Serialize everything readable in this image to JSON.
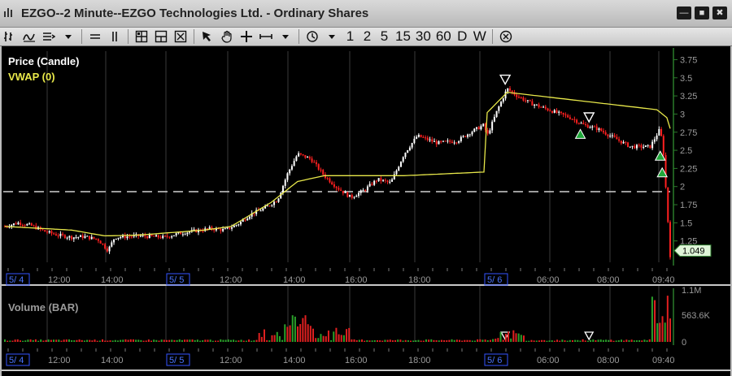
{
  "window": {
    "title": "EZGO--2 Minute--EZGO Technologies Ltd. - Ordinary Shares",
    "buttons": [
      "—",
      "■",
      "✖"
    ]
  },
  "toolbar": {
    "timeframes": [
      "1",
      "2",
      "5",
      "15",
      "30",
      "60",
      "D",
      "W"
    ]
  },
  "price_panel": {
    "legend": [
      {
        "label": "Price (Candle)",
        "color": "#ffffff"
      },
      {
        "label": "VWAP (0)",
        "color": "#e8e84a"
      }
    ],
    "y_ticks": [
      "3.75",
      "3.5",
      "3.25",
      "3",
      "2.75",
      "2.5",
      "2.25",
      "2",
      "1.75",
      "1.5",
      "1.25"
    ],
    "last_price": "1.049"
  },
  "volume_panel": {
    "legend": "Volume (BAR)",
    "y_ticks": [
      "1.1M",
      "563.6K",
      "0"
    ]
  },
  "x_axis": {
    "date_labels": [
      "5/ 4",
      "5/ 5",
      "5/ 6"
    ],
    "time_labels": [
      "12:00",
      "14:00",
      "12:00",
      "14:00",
      "16:00",
      "18:00",
      "06:00",
      "08:00",
      "09:40"
    ]
  },
  "colors": {
    "up": "#ffffff",
    "down": "#ff2020",
    "vwap": "#e8e84a",
    "vol_up": "#2aa02a",
    "vol_down": "#e02020",
    "grid": "#3a3a3a",
    "axis_text": "#9a9a9a",
    "date_box": "#3355ff"
  },
  "chart_data": {
    "type": "candlestick",
    "symbol": "EZGO",
    "interval": "2 Minute",
    "ylim": [
      1.0,
      3.8
    ],
    "price_path": [
      [
        0,
        1.45
      ],
      [
        0.02,
        1.5
      ],
      [
        0.04,
        1.46
      ],
      [
        0.06,
        1.38
      ],
      [
        0.08,
        1.33
      ],
      [
        0.1,
        1.3
      ],
      [
        0.12,
        1.31
      ],
      [
        0.14,
        1.27
      ],
      [
        0.155,
        1.12
      ],
      [
        0.165,
        1.3
      ],
      [
        0.2,
        1.32
      ],
      [
        0.24,
        1.3
      ],
      [
        0.26,
        1.35
      ],
      [
        0.28,
        1.38
      ],
      [
        0.31,
        1.42
      ],
      [
        0.33,
        1.4
      ],
      [
        0.35,
        1.48
      ],
      [
        0.37,
        1.62
      ],
      [
        0.39,
        1.7
      ],
      [
        0.41,
        1.82
      ],
      [
        0.425,
        2.18
      ],
      [
        0.44,
        2.45
      ],
      [
        0.46,
        2.38
      ],
      [
        0.48,
        2.15
      ],
      [
        0.5,
        1.98
      ],
      [
        0.52,
        1.85
      ],
      [
        0.54,
        1.95
      ],
      [
        0.56,
        2.1
      ],
      [
        0.58,
        2.05
      ],
      [
        0.6,
        2.45
      ],
      [
        0.62,
        2.7
      ],
      [
        0.65,
        2.6
      ],
      [
        0.68,
        2.63
      ],
      [
        0.7,
        2.75
      ],
      [
        0.72,
        2.85
      ],
      [
        0.725,
        2.7
      ],
      [
        0.74,
        3.05
      ],
      [
        0.755,
        3.35
      ],
      [
        0.77,
        3.25
      ],
      [
        0.79,
        3.15
      ],
      [
        0.82,
        3.05
      ],
      [
        0.85,
        2.95
      ],
      [
        0.87,
        2.85
      ],
      [
        0.89,
        2.8
      ],
      [
        0.91,
        2.7
      ],
      [
        0.94,
        2.55
      ],
      [
        0.97,
        2.55
      ],
      [
        0.985,
        2.8
      ],
      [
        0.99,
        2.45
      ],
      [
        1.0,
        1.05
      ]
    ],
    "vwap_path": [
      [
        0,
        1.45
      ],
      [
        0.1,
        1.4
      ],
      [
        0.15,
        1.32
      ],
      [
        0.2,
        1.33
      ],
      [
        0.3,
        1.4
      ],
      [
        0.34,
        1.45
      ],
      [
        0.4,
        1.78
      ],
      [
        0.44,
        2.07
      ],
      [
        0.48,
        2.15
      ],
      [
        0.6,
        2.15
      ],
      [
        0.72,
        2.2
      ],
      [
        0.725,
        3.02
      ],
      [
        0.755,
        3.3
      ],
      [
        0.98,
        3.06
      ],
      [
        0.995,
        2.95
      ],
      [
        1.0,
        2.8
      ]
    ],
    "buy_signals": [
      [
        0.865,
        2.72
      ],
      [
        0.985,
        2.42
      ],
      [
        0.988,
        2.19
      ]
    ],
    "sell_signals": [
      [
        0.752,
        3.48
      ],
      [
        0.878,
        2.96
      ]
    ],
    "volume_sell_signals": [
      0.752,
      0.878
    ],
    "reference_line": 1.93,
    "volume_ylim": [
      0,
      1100000
    ],
    "volume_ticks": [
      0,
      563600,
      1100000
    ]
  }
}
